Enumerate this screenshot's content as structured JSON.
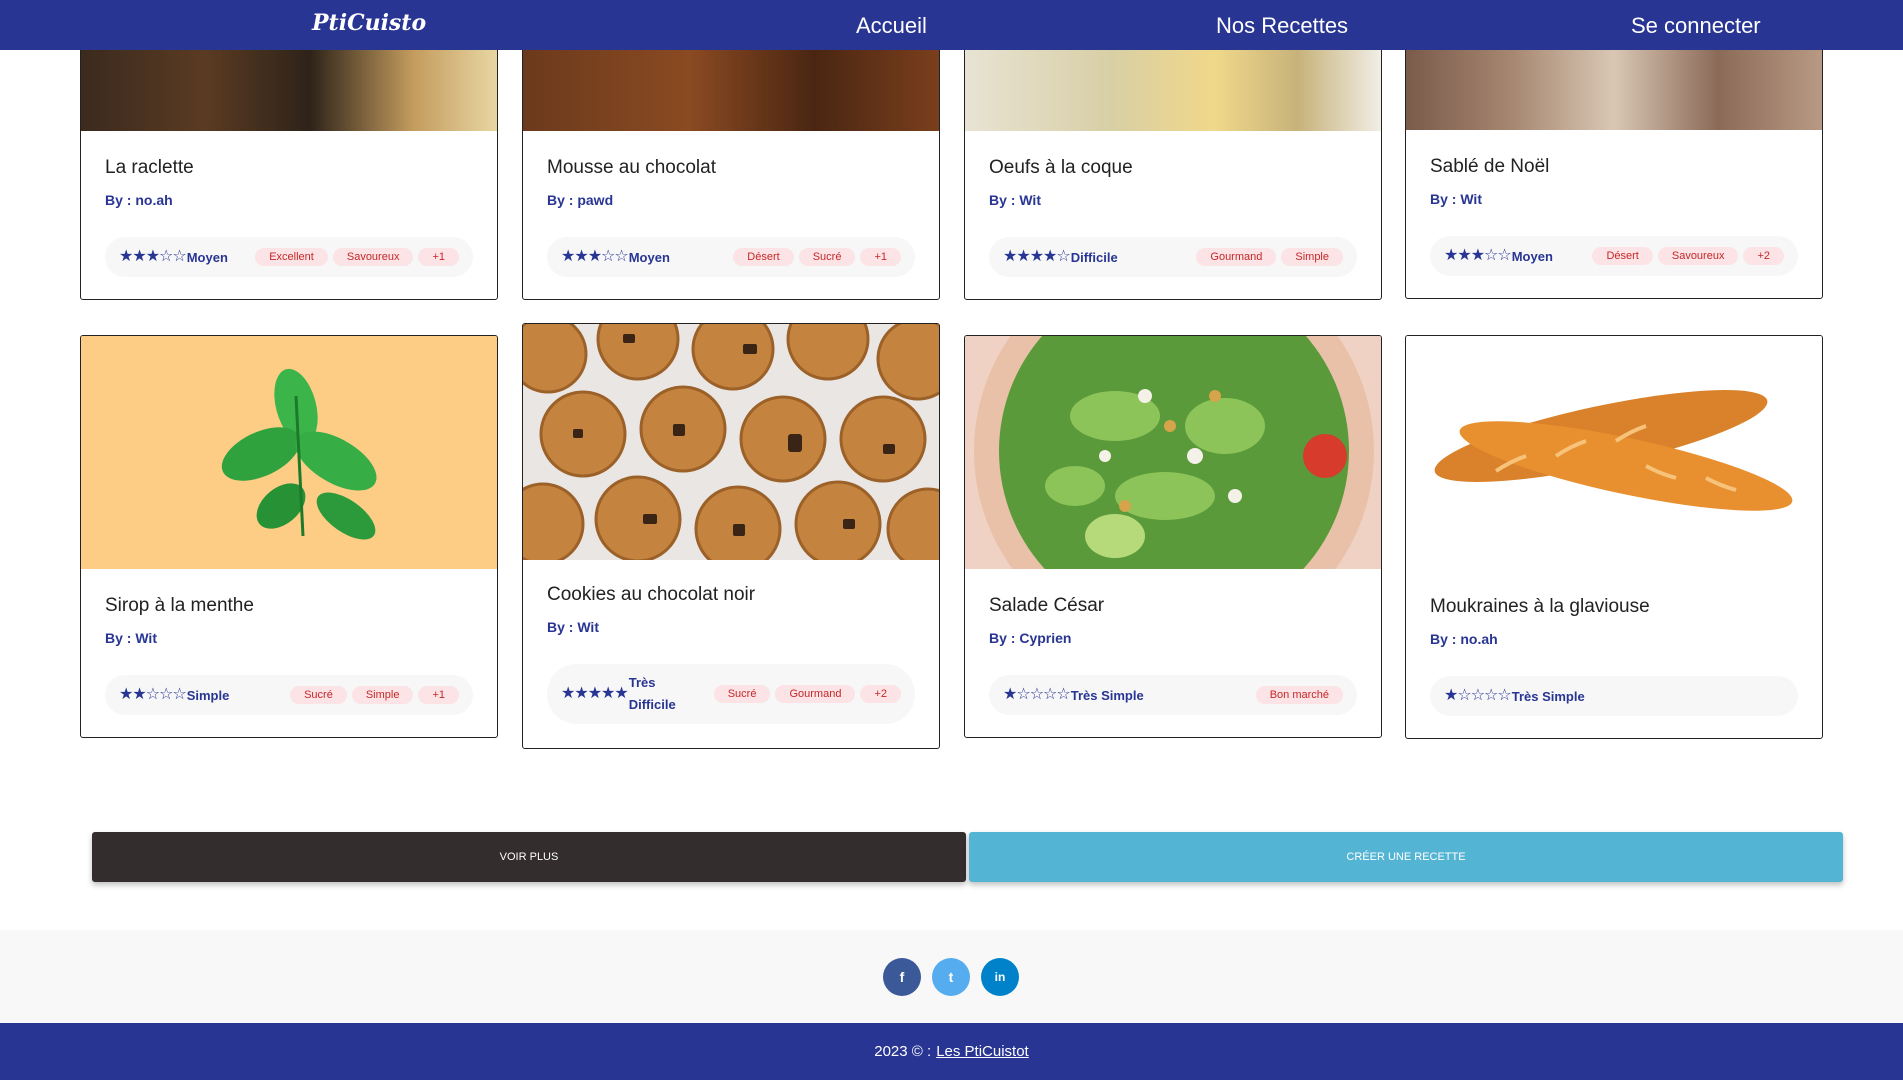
{
  "nav": {
    "brand": "PtiCuisto",
    "links": [
      "Accueil",
      "Nos Recettes",
      "Se connecter"
    ]
  },
  "recipes": [
    {
      "title": "La raclette",
      "author": "By : no.ah",
      "rating": 3,
      "difficulty": "Moyen",
      "tags": [
        "Excellent",
        "Savoureux",
        "+1"
      ]
    },
    {
      "title": "Mousse au chocolat",
      "author": "By : pawd",
      "rating": 3,
      "difficulty": "Moyen",
      "tags": [
        "Désert",
        "Sucré",
        "+1"
      ]
    },
    {
      "title": "Oeufs à la coque",
      "author": "By : Wit",
      "rating": 4,
      "difficulty": "Difficile",
      "tags": [
        "Gourmand",
        "Simple"
      ]
    },
    {
      "title": "Sablé de Noël",
      "author": "By : Wit",
      "rating": 3,
      "difficulty": "Moyen",
      "tags": [
        "Désert",
        "Savoureux",
        "+2"
      ]
    },
    {
      "title": "Sirop à la menthe",
      "author": "By : Wit",
      "rating": 2,
      "difficulty": "Simple",
      "tags": [
        "Sucré",
        "Simple",
        "+1"
      ]
    },
    {
      "title": "Cookies au chocolat noir",
      "author": "By : Wit",
      "rating": 5,
      "difficulty": "Très Difficile",
      "tags": [
        "Sucré",
        "Gourmand",
        "+2"
      ]
    },
    {
      "title": "Salade César",
      "author": "By : Cyprien",
      "rating": 1,
      "difficulty": "Très Simple",
      "tags": [
        "Bon marché"
      ]
    },
    {
      "title": "Moukraines à la glaviouse",
      "author": "By : no.ah",
      "rating": 1,
      "difficulty": "Très Simple",
      "tags": []
    }
  ],
  "buttons": {
    "see_more": "Voir plus",
    "create": "Créer une recette"
  },
  "social": {
    "facebook": "f",
    "twitter": "t",
    "linkedin": "in"
  },
  "footer": {
    "copyright": "2023 © :",
    "link": "Les PtiCuistot"
  },
  "colors": {
    "primary": "#283593",
    "see_more_bg": "#332d2d",
    "create_bg": "#54b4d3",
    "tag_bg": "#fbe3e6",
    "tag_text": "#c62828",
    "facebook": "#3b5998",
    "twitter": "#55acee",
    "linkedin": "#0082ca"
  }
}
